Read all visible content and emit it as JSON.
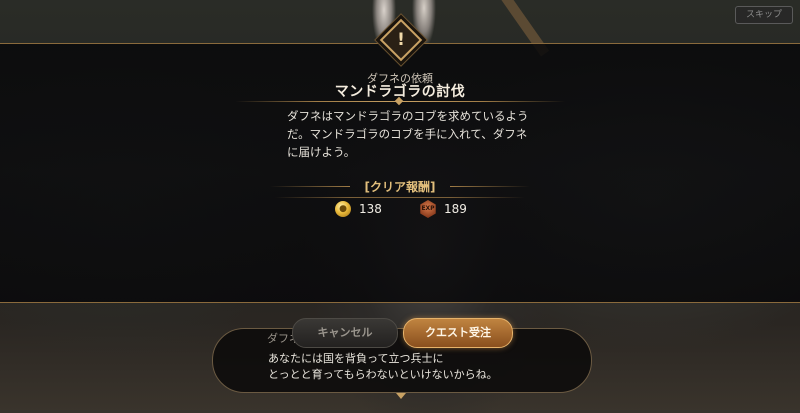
{
  "top_bar": {
    "skip_label": "スキップ"
  },
  "quest": {
    "emblem_icon": "exclamation-icon",
    "client": "ダフネの依頼",
    "title": "マンドラゴラの討伐",
    "description": "ダフネはマンドラゴラのコブを求めているようだ。マンドラゴラのコブを手に入れて、ダフネに届けよう。",
    "reward_header": "[クリア報酬]",
    "rewards": [
      {
        "icon": "gold-coin-icon",
        "value": "138"
      },
      {
        "icon": "exp-icon",
        "icon_text": "EXP",
        "value": "189"
      }
    ]
  },
  "actions": {
    "cancel_label": "キャンセル",
    "accept_label": "クエスト受注"
  },
  "dialogue": {
    "speaker": "ダフネ",
    "text": "あなたには国を背負って立つ兵士に\nとっとと育ってもらわないといけないからね。"
  },
  "colors": {
    "accent_gold": "#c9a264",
    "accept_button": "#b0743a",
    "title_text": "#f4ecde"
  }
}
